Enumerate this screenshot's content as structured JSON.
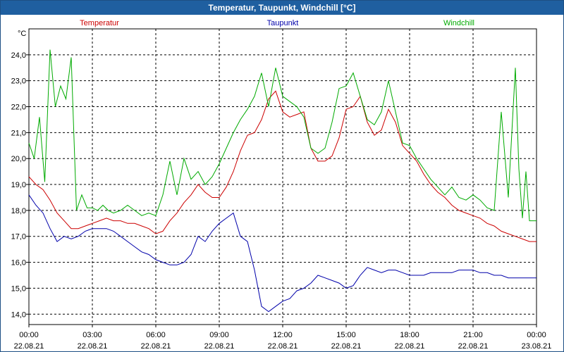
{
  "window": {
    "title": "Temperatur, Taupunkt, Windchill [°C]"
  },
  "colors": {
    "temperatur": "#cc0000",
    "taupunkt": "#0000aa",
    "windchill": "#00aa00",
    "grid": "#000000"
  },
  "chart_data": {
    "type": "line",
    "title": "Temperatur, Taupunkt, Windchill [°C]",
    "ylabel": "°C",
    "ylim": [
      13.6,
      25.0
    ],
    "xlim": [
      "22.08.21 00:00",
      "23.08.21 00:00"
    ],
    "grid": true,
    "legend_placement": "top",
    "yticks": [
      "14,0",
      "15,0",
      "16,0",
      "17,0",
      "18,0",
      "19,0",
      "20,0",
      "21,0",
      "22,0",
      "23,0",
      "24,0"
    ],
    "xticks": [
      {
        "time": "00:00",
        "date": "22.08.21"
      },
      {
        "time": "03:00",
        "date": "22.08.21"
      },
      {
        "time": "06:00",
        "date": "22.08.21"
      },
      {
        "time": "09:00",
        "date": "22.08.21"
      },
      {
        "time": "12:00",
        "date": "22.08.21"
      },
      {
        "time": "15:00",
        "date": "22.08.21"
      },
      {
        "time": "18:00",
        "date": "22.08.21"
      },
      {
        "time": "21:00",
        "date": "22.08.21"
      },
      {
        "time": "00:00",
        "date": "23.08.21"
      }
    ],
    "series": [
      {
        "name": "Temperatur",
        "x": [
          "00:00",
          "00:20",
          "00:40",
          "01:00",
          "01:20",
          "01:40",
          "02:00",
          "02:20",
          "02:40",
          "03:00",
          "03:20",
          "03:40",
          "04:00",
          "04:20",
          "04:40",
          "05:00",
          "05:20",
          "05:40",
          "06:00",
          "06:20",
          "06:40",
          "07:00",
          "07:20",
          "07:40",
          "08:00",
          "08:20",
          "08:40",
          "09:00",
          "09:20",
          "09:40",
          "10:00",
          "10:20",
          "10:40",
          "11:00",
          "11:20",
          "11:40",
          "12:00",
          "12:20",
          "12:40",
          "13:00",
          "13:20",
          "13:40",
          "14:00",
          "14:20",
          "14:40",
          "15:00",
          "15:20",
          "15:40",
          "16:00",
          "16:20",
          "16:40",
          "17:00",
          "17:20",
          "17:40",
          "18:00",
          "18:20",
          "18:40",
          "19:00",
          "19:20",
          "19:40",
          "20:00",
          "20:20",
          "20:40",
          "21:00",
          "21:20",
          "21:40",
          "22:00",
          "22:20",
          "22:40",
          "23:00",
          "23:20",
          "23:40",
          "24:00"
        ],
        "values": [
          19.3,
          19.0,
          18.8,
          18.4,
          17.9,
          17.6,
          17.3,
          17.3,
          17.4,
          17.5,
          17.6,
          17.7,
          17.6,
          17.6,
          17.5,
          17.5,
          17.4,
          17.3,
          17.1,
          17.2,
          17.6,
          17.9,
          18.3,
          18.6,
          19.0,
          18.7,
          18.5,
          18.5,
          18.9,
          19.5,
          20.3,
          20.9,
          21.0,
          21.5,
          22.3,
          22.6,
          21.8,
          21.6,
          21.7,
          21.8,
          20.4,
          19.9,
          19.9,
          20.1,
          20.8,
          21.9,
          22.0,
          22.4,
          21.4,
          20.9,
          21.1,
          21.9,
          21.4,
          20.5,
          20.2,
          19.9,
          19.4,
          19.0,
          18.7,
          18.5,
          18.2,
          18.0,
          17.9,
          17.8,
          17.7,
          17.5,
          17.4,
          17.2,
          17.1,
          17.0,
          16.9,
          16.8,
          16.8
        ]
      },
      {
        "name": "Taupunkt",
        "x": [
          "00:00",
          "00:20",
          "00:40",
          "01:00",
          "01:20",
          "01:40",
          "02:00",
          "02:20",
          "02:40",
          "03:00",
          "03:20",
          "03:40",
          "04:00",
          "04:20",
          "04:40",
          "05:00",
          "05:20",
          "05:40",
          "06:00",
          "06:20",
          "06:40",
          "07:00",
          "07:20",
          "07:40",
          "08:00",
          "08:20",
          "08:40",
          "09:00",
          "09:20",
          "09:40",
          "10:00",
          "10:20",
          "10:40",
          "11:00",
          "11:20",
          "11:40",
          "12:00",
          "12:20",
          "12:40",
          "13:00",
          "13:20",
          "13:40",
          "14:00",
          "14:20",
          "14:40",
          "15:00",
          "15:20",
          "15:40",
          "16:00",
          "16:20",
          "16:40",
          "17:00",
          "17:20",
          "17:40",
          "18:00",
          "18:20",
          "18:40",
          "19:00",
          "19:20",
          "19:40",
          "20:00",
          "20:20",
          "20:40",
          "21:00",
          "21:20",
          "21:40",
          "22:00",
          "22:20",
          "22:40",
          "23:00",
          "23:20",
          "23:40",
          "24:00"
        ],
        "values": [
          18.6,
          18.2,
          17.9,
          17.3,
          16.8,
          17.0,
          16.9,
          17.0,
          17.2,
          17.3,
          17.3,
          17.3,
          17.2,
          17.0,
          16.8,
          16.6,
          16.4,
          16.3,
          16.1,
          16.0,
          15.9,
          15.9,
          16.0,
          16.3,
          17.0,
          16.8,
          17.2,
          17.5,
          17.7,
          17.9,
          17.0,
          16.8,
          15.7,
          14.3,
          14.1,
          14.3,
          14.5,
          14.6,
          14.9,
          15.0,
          15.2,
          15.5,
          15.4,
          15.3,
          15.2,
          15.0,
          15.1,
          15.5,
          15.8,
          15.7,
          15.6,
          15.7,
          15.7,
          15.6,
          15.5,
          15.5,
          15.5,
          15.6,
          15.6,
          15.6,
          15.6,
          15.7,
          15.7,
          15.7,
          15.6,
          15.6,
          15.5,
          15.5,
          15.4,
          15.4,
          15.4,
          15.4,
          15.4
        ]
      },
      {
        "name": "Windchill",
        "x": [
          "00:00",
          "00:15",
          "00:30",
          "00:45",
          "01:00",
          "01:15",
          "01:30",
          "01:45",
          "02:00",
          "02:15",
          "02:30",
          "02:45",
          "03:00",
          "03:15",
          "03:30",
          "03:45",
          "04:00",
          "04:20",
          "04:40",
          "05:00",
          "05:20",
          "05:40",
          "06:00",
          "06:20",
          "06:40",
          "07:00",
          "07:20",
          "07:40",
          "08:00",
          "08:20",
          "08:40",
          "09:00",
          "09:20",
          "09:40",
          "10:00",
          "10:20",
          "10:40",
          "11:00",
          "11:20",
          "11:40",
          "12:00",
          "12:20",
          "12:40",
          "13:00",
          "13:20",
          "13:40",
          "14:00",
          "14:20",
          "14:40",
          "15:00",
          "15:20",
          "15:40",
          "16:00",
          "16:20",
          "16:40",
          "17:00",
          "17:20",
          "17:40",
          "18:00",
          "18:20",
          "18:40",
          "19:00",
          "19:20",
          "19:40",
          "20:00",
          "20:20",
          "20:40",
          "21:00",
          "21:20",
          "21:40",
          "22:00",
          "22:20",
          "22:40",
          "23:00",
          "23:10",
          "23:20",
          "23:30",
          "23:40",
          "23:50",
          "24:00"
        ],
        "values": [
          20.6,
          20.0,
          21.6,
          19.1,
          24.2,
          22.0,
          22.8,
          22.3,
          23.9,
          18.0,
          18.6,
          18.1,
          18.1,
          18.0,
          18.2,
          18.0,
          17.9,
          18.0,
          18.2,
          18.0,
          17.8,
          17.9,
          17.8,
          18.6,
          19.9,
          18.6,
          20.0,
          19.2,
          19.5,
          19.0,
          19.3,
          19.8,
          20.4,
          21.0,
          21.5,
          21.9,
          22.4,
          23.3,
          22.0,
          23.5,
          22.4,
          22.2,
          22.0,
          21.6,
          20.4,
          20.2,
          20.4,
          21.4,
          22.7,
          22.8,
          23.3,
          22.4,
          21.5,
          21.3,
          21.8,
          23.0,
          21.8,
          20.6,
          20.5,
          20.0,
          19.6,
          19.2,
          18.9,
          18.6,
          18.9,
          18.5,
          18.4,
          18.6,
          18.4,
          18.1,
          18.0,
          21.8,
          18.5,
          23.5,
          19.6,
          17.7,
          19.5,
          17.6,
          17.6,
          17.6
        ]
      }
    ]
  }
}
